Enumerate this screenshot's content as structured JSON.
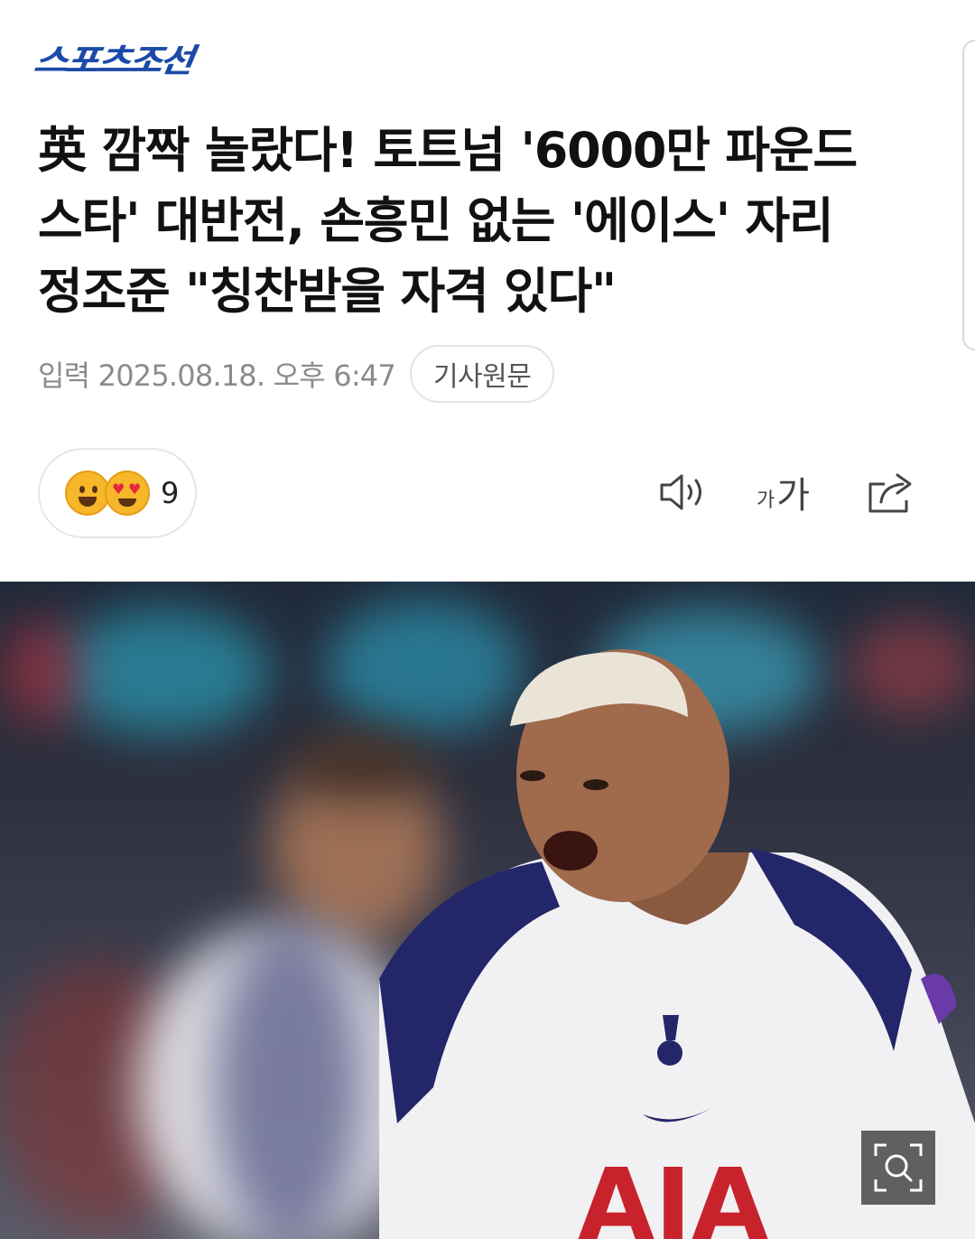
{
  "header": {
    "logo_text": "스포츠조선",
    "brand_color": "#1b4aa8"
  },
  "article": {
    "headline_lines": [
      "英 깜짝 놀랐다! 토트넘 '6000만 파운드",
      "스타' 대반전, 손흥민 없는 '에이스' 자리",
      "정조준 \"칭찬받을 자격 있다\""
    ],
    "published": "입력 2025.08.18. 오후 6:47",
    "original_article_label": "기사원문"
  },
  "reactions": {
    "count": "9",
    "icons": [
      "smile-emoji-icon",
      "heart-eyes-emoji-icon"
    ]
  },
  "toolbar": {
    "icons": [
      "speaker-icon",
      "font-size-icon",
      "share-icon"
    ],
    "font_size_small": "가",
    "font_size_big": "가"
  },
  "hero_image": {
    "description_icon": "zoom-icon"
  }
}
